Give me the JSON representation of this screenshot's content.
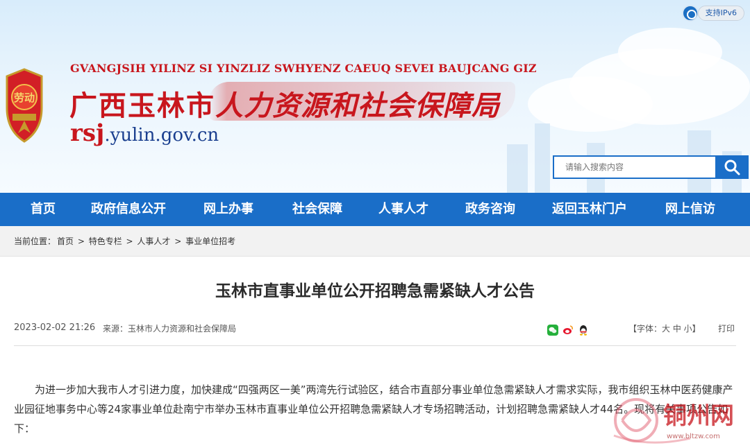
{
  "header": {
    "ipv6_label": "支持IPv6",
    "pinyin_name": "GVANGJSIH YILINZ SI YINZLIZ SWHYENZ CAEUQ SEVEI BAUJCANG GIZ",
    "city_name": "广西玉林市",
    "bureau_name": "人力资源和社会保障局",
    "domain_prefix": "rsj",
    "domain_suffix": ".yulin.gov.cn",
    "emblem_text": "劳动",
    "search_placeholder": "请输入搜索内容"
  },
  "nav": {
    "items": [
      {
        "label": "首页"
      },
      {
        "label": "政府信息公开"
      },
      {
        "label": "网上办事"
      },
      {
        "label": "社会保障"
      },
      {
        "label": "人事人才"
      },
      {
        "label": "政务咨询"
      },
      {
        "label": "返回玉林门户"
      },
      {
        "label": "网上信访"
      }
    ]
  },
  "breadcrumb": {
    "label": "当前位置：",
    "items": [
      "首页",
      "特色专栏",
      "人事人才",
      "事业单位招考"
    ],
    "separator": " > "
  },
  "article": {
    "title": "玉林市直事业单位公开招聘急需紧缺人才公告",
    "date": "2023-02-02 21:26",
    "source": "来源：玉林市人力资源和社会保障局",
    "font_size_label": "【字体：大 中 小】",
    "print_label": "打印",
    "body": "为进一步加大我市人才引进力度，加快建成“四强两区一美”两湾先行试验区，结合市直部分事业单位急需紧缺人才需求实际，我市组织玉林中医药健康产业园征地事务中心等24家事业单位赴南宁市举办玉林市直事业单位公开招聘急需紧缺人才专场招聘活动，计划招聘急需紧缺人才44名。现将有关事项公告如下："
  },
  "share_icons": [
    "wechat-icon",
    "weibo-icon",
    "qq-icon"
  ],
  "watermark": {
    "text": "铜州网",
    "url": "www.bltzw.com"
  },
  "colors": {
    "nav_blue": "#1a6ec8",
    "title_red": "#c8161d",
    "domain_blue": "#1a3f8f"
  }
}
